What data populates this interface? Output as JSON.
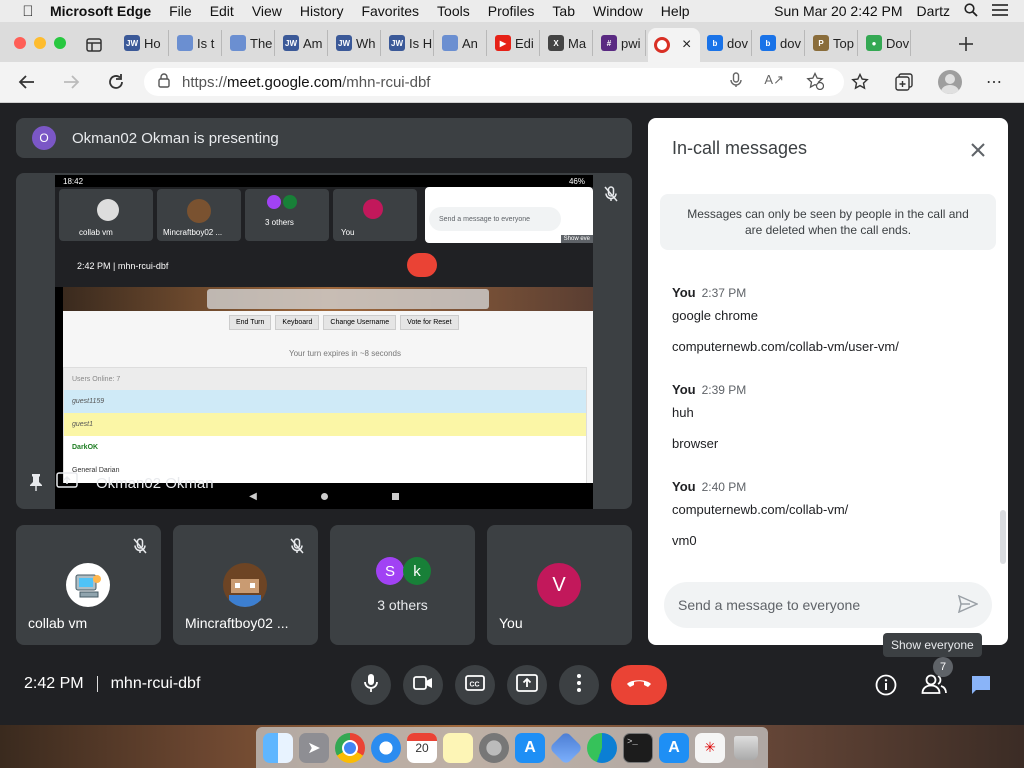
{
  "menubar": {
    "app": "Microsoft Edge",
    "items": [
      "File",
      "Edit",
      "View",
      "History",
      "Favorites",
      "Tools",
      "Profiles",
      "Tab",
      "Window",
      "Help"
    ],
    "clock": "Sun Mar 20  2:42 PM",
    "user": "Dartz"
  },
  "tabs": [
    {
      "fav": "JW",
      "label": "Ho",
      "color": "#3b5998"
    },
    {
      "fav": "",
      "label": "Is t",
      "color": "#6b8fd1"
    },
    {
      "fav": "",
      "label": "The",
      "color": "#6b8fd1"
    },
    {
      "fav": "JW",
      "label": "Am",
      "color": "#3b5998"
    },
    {
      "fav": "JW",
      "label": "Wh",
      "color": "#3b5998"
    },
    {
      "fav": "JW",
      "label": "Is H",
      "color": "#3b5998"
    },
    {
      "fav": "",
      "label": "An",
      "color": "#6b8fd1"
    },
    {
      "fav": "▶",
      "label": "Edi",
      "color": "#e62117"
    },
    {
      "fav": "X",
      "label": "Ma",
      "color": "#444444"
    },
    {
      "fav": "#",
      "label": "pwi",
      "color": "#5a2a82"
    },
    {
      "fav": "",
      "label": "",
      "color": "#d93025",
      "active": true
    },
    {
      "fav": "b",
      "label": "dov",
      "color": "#1a73e8"
    },
    {
      "fav": "b",
      "label": "dov",
      "color": "#1a73e8"
    },
    {
      "fav": "P",
      "label": "Top",
      "color": "#8a6d3b"
    },
    {
      "fav": "●",
      "label": "Dov",
      "color": "#34a853"
    }
  ],
  "address": {
    "scheme": "https://",
    "host": "meet.google.com",
    "path": "/mhn-rcui-dbf"
  },
  "meet": {
    "presenter_initial": "O",
    "presenting_text": "Okman02 Okman is presenting",
    "presenter_tile_name": "Okman02 Okman",
    "tiles": [
      {
        "name": "collab vm",
        "muted": true
      },
      {
        "name": "Mincraftboy02 ...",
        "muted": true
      },
      {
        "name": "3 others",
        "initials": [
          "S",
          "k"
        ],
        "muted": false
      },
      {
        "name": "You",
        "initial": "V",
        "muted": false
      }
    ],
    "time": "2:42 PM",
    "meeting_code": "mhn-rcui-dbf",
    "participant_count": "7",
    "tooltip": "Show everyone"
  },
  "shared_screen": {
    "status_time": "18:42",
    "battery": "46%",
    "mini_tiles": [
      "collab vm",
      "Mincraftboy02 ...",
      "3 others",
      "You"
    ],
    "mini_message_placeholder": "Send a message to everyone",
    "mini_show": "Show eve",
    "mini_time_code": "2:42 PM  |  mhn-rcui-dbf",
    "buttons": [
      "End Turn",
      "Keyboard",
      "Change Username",
      "Vote for Reset"
    ],
    "turn_text": "Your turn expires in ~8 seconds",
    "users_header": "Users Online: 7",
    "users": [
      "guest1159",
      "guest1",
      "DarkOK",
      "General Darian"
    ]
  },
  "chat": {
    "title": "In-call messages",
    "notice": "Messages can only be seen by people in the call and are deleted when the call ends.",
    "groups": [
      {
        "sender": "You",
        "time": "2:37 PM",
        "lines": [
          "google chrome",
          "computernewb.com/collab-vm/user-vm/"
        ]
      },
      {
        "sender": "You",
        "time": "2:39 PM",
        "lines": [
          "huh",
          "browser"
        ]
      },
      {
        "sender": "You",
        "time": "2:40 PM",
        "lines": [
          "computernewb.com/collab-vm/",
          "vm0"
        ]
      }
    ],
    "input_placeholder": "Send a message to everyone"
  }
}
